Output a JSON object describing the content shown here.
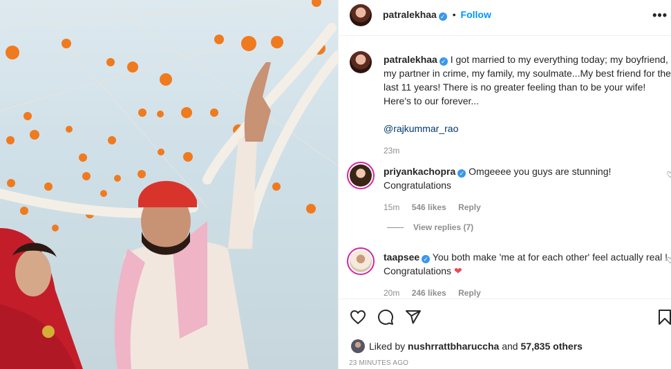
{
  "post": {
    "username": "patralekhaa",
    "follow_label": "Follow",
    "separator": "•",
    "verified_mark": "✓",
    "more_label": "•••"
  },
  "caption": {
    "username": "patralekhaa",
    "text": "I got married to my everything today; my boyfriend, my partner in crime, my family, my soulmate...My best friend for the last 11 years! There is no greater feeling than to be your wife! Here's to our forever...",
    "mention": "@rajkummar_rao",
    "time": "23m"
  },
  "comments": [
    {
      "username": "priyankachopra",
      "text": "Omgeeee you guys are stunning! Congratulations",
      "time": "15m",
      "likes": "546 likes",
      "reply": "Reply",
      "view_replies": "View replies (7)"
    },
    {
      "username": "taapsee",
      "text": "You both make 'me at for each other' feel actually real ! Congratulations",
      "emoji": "❤",
      "time": "20m",
      "likes": "246 likes",
      "reply": "Reply"
    }
  ],
  "likes": {
    "prefix": "Liked by",
    "user": "nushrrattbharuccha",
    "and": "and",
    "others": "57,835 others"
  },
  "timestamp": "23 MINUTES AGO",
  "icons": [
    "heart-icon",
    "comment-icon",
    "share-icon",
    "bookmark-icon",
    "verified-icon",
    "more-icon"
  ],
  "colors": {
    "accent": "#0095f6",
    "verified": "#3897f0",
    "heart": "#ed4956",
    "muted": "#8e8e8e"
  }
}
